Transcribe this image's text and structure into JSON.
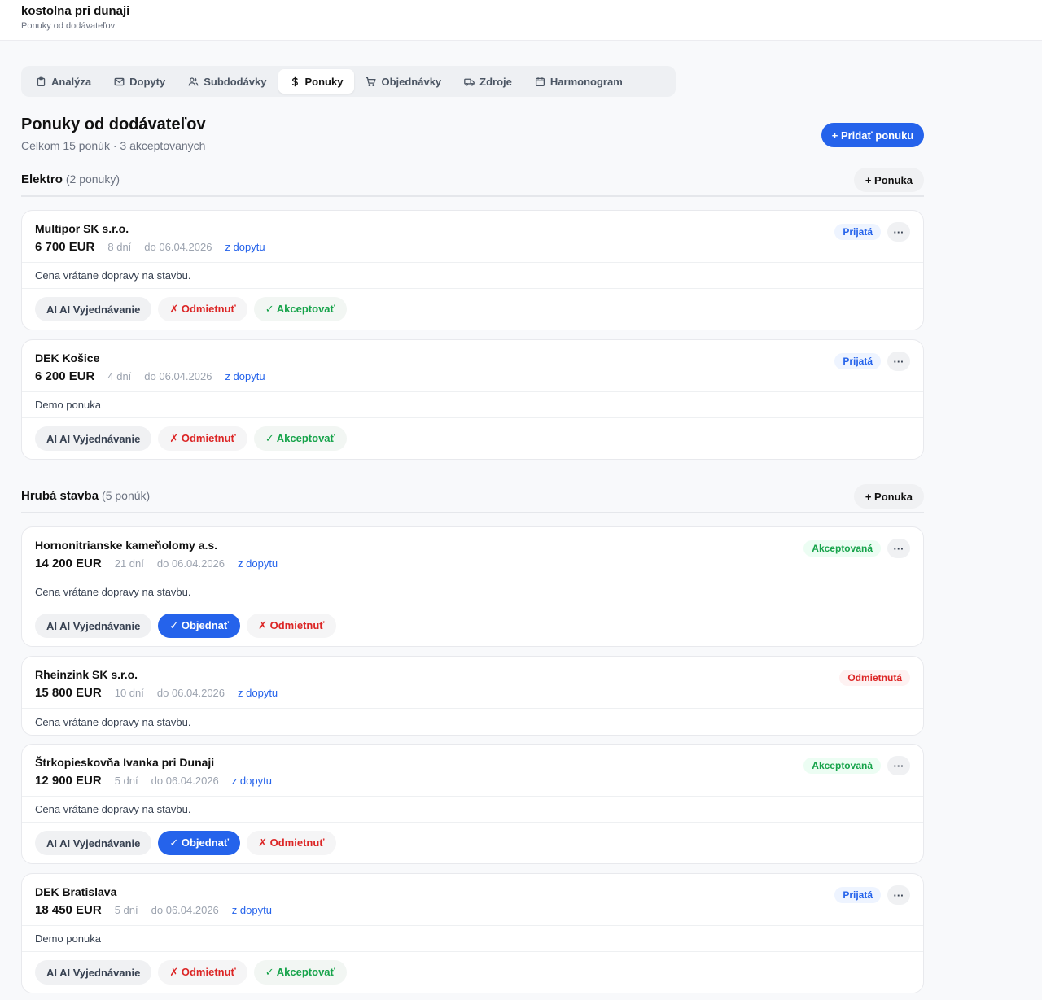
{
  "header": {
    "project_name": "kostolna pri dunaji",
    "subtitle": "Ponuky od dodávateľov"
  },
  "tabs": [
    {
      "label": "Analýza",
      "icon": "clipboard-icon"
    },
    {
      "label": "Dopyty",
      "icon": "mail-icon"
    },
    {
      "label": "Subdodávky",
      "icon": "users-icon"
    },
    {
      "label": "Ponuky",
      "icon": "dollar-icon",
      "active": true
    },
    {
      "label": "Objednávky",
      "icon": "cart-icon"
    },
    {
      "label": "Zdroje",
      "icon": "truck-icon"
    },
    {
      "label": "Harmonogram",
      "icon": "calendar-icon"
    }
  ],
  "page": {
    "title": "Ponuky od dodávateľov",
    "summary": "Celkom 15 ponúk · 3 akceptovaných",
    "add_label": "+ Pridať ponuku"
  },
  "groups": [
    {
      "name": "Elektro",
      "count": "(2 ponuky)",
      "add_label": "+ Ponuka"
    },
    {
      "name": "Hrubá stavba",
      "count": "(5 ponúk)",
      "add_label": "+ Ponuka"
    }
  ],
  "labels": {
    "ai": "AI AI Vyjednávanie",
    "reject": "✗ Odmietnuť",
    "accept": "✓ Akceptovať",
    "order": "✓ Objednať",
    "more": "···"
  },
  "offers": [
    {
      "supplier": "Multipor SK s.r.o.",
      "price": "6 700 EUR",
      "days": "8 dní",
      "deadline": "do 06.04.2026",
      "source": "z dopytu",
      "note": "Cena vrátane dopravy na stavbu.",
      "status": "Prijatá"
    },
    {
      "supplier": "DEK Košice",
      "price": "6 200 EUR",
      "days": "4 dní",
      "deadline": "do 06.04.2026",
      "source": "z dopytu",
      "note": "Demo ponuka",
      "status": "Prijatá"
    },
    {
      "supplier": "Hornonitrianske kameňolomy a.s.",
      "price": "14 200 EUR",
      "days": "21 dní",
      "deadline": "do 06.04.2026",
      "source": "z dopytu",
      "note": "Cena vrátane dopravy na stavbu.",
      "status": "Akceptovaná"
    },
    {
      "supplier": "Rheinzink SK s.r.o.",
      "price": "15 800 EUR",
      "days": "10 dní",
      "deadline": "do 06.04.2026",
      "source": "z dopytu",
      "note": "Cena vrátane dopravy na stavbu.",
      "status": "Odmietnutá"
    },
    {
      "supplier": "Štrkopieskovňa Ivanka pri Dunaji",
      "price": "12 900 EUR",
      "days": "5 dní",
      "deadline": "do 06.04.2026",
      "source": "z dopytu",
      "note": "Cena vrátane dopravy na stavbu.",
      "status": "Akceptovaná"
    },
    {
      "supplier": "DEK Bratislava",
      "price": "18 450 EUR",
      "days": "5 dní",
      "deadline": "do 06.04.2026",
      "source": "z dopytu",
      "note": "Demo ponuka",
      "status": "Prijatá"
    }
  ]
}
